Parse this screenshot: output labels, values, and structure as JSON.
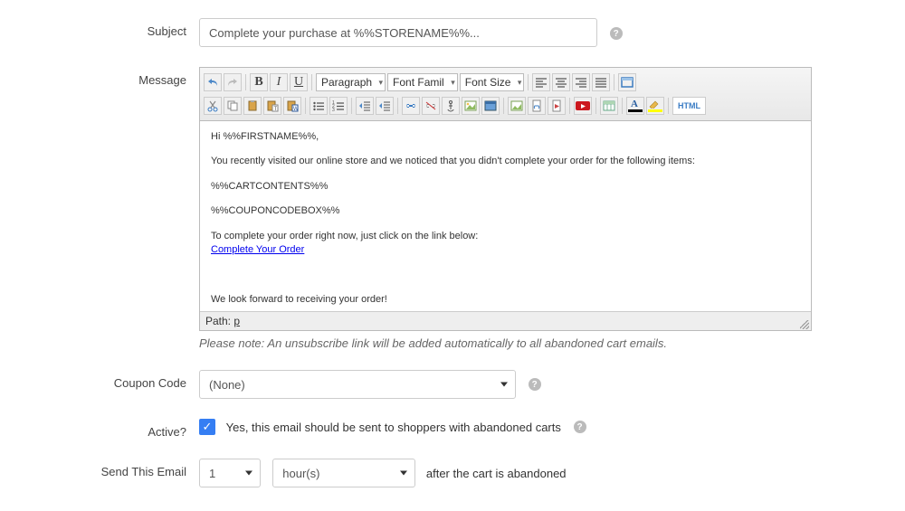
{
  "labels": {
    "subject": "Subject",
    "message": "Message",
    "coupon": "Coupon Code",
    "active": "Active?",
    "send": "Send This Email"
  },
  "subject": {
    "value": "Complete your purchase at %%STORENAME%%..."
  },
  "editor": {
    "format_dropdown": "Paragraph",
    "font_family_dropdown": "Font Famil",
    "font_size_dropdown": "Font Size",
    "html_btn": "HTML",
    "body": {
      "greeting": "Hi %%FIRSTNAME%%,",
      "line1": "You recently visited our online store and we noticed that you didn't complete your order for the following items:",
      "cart": "%%CARTCONTENTS%%",
      "coupon": "%%COUPONCODEBOX%%",
      "line2": "To complete your order right now, just click on the link below:",
      "link": "Complete Your Order",
      "closing": "We look forward to receiving your order!"
    },
    "path_label": "Path:",
    "path_value": "p"
  },
  "note": "Please note: An unsubscribe link will be added automatically to all abandoned cart emails.",
  "coupon": {
    "value": "(None)"
  },
  "active": {
    "text": "Yes, this email should be sent to shoppers with abandoned carts"
  },
  "send": {
    "qty": "1",
    "unit": "hour(s)",
    "after": "after the cart is abandoned"
  }
}
